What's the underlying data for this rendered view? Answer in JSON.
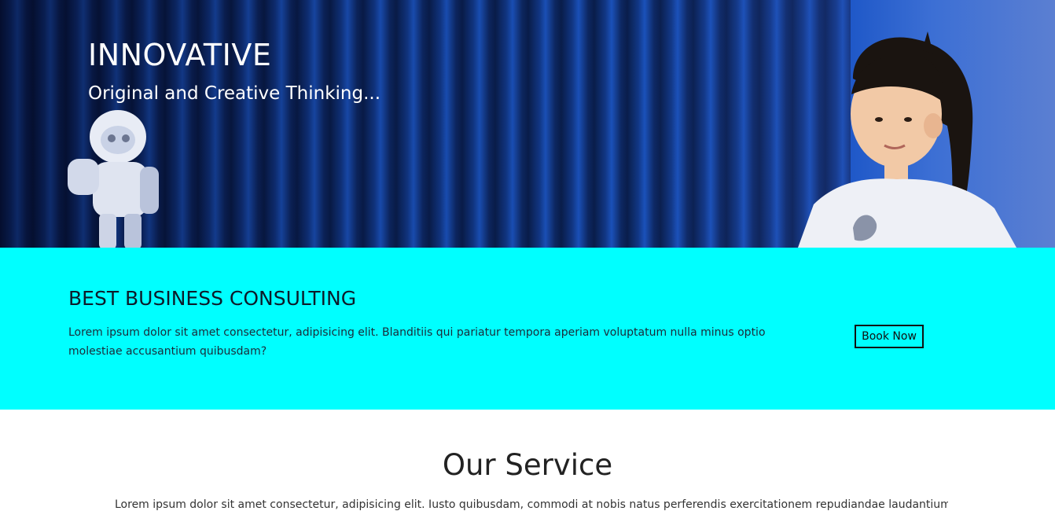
{
  "hero": {
    "title": "INNOVATIVE",
    "subtitle": "Original and Creative Thinking..."
  },
  "consulting": {
    "title": "BEST BUSINESS CONSULTING",
    "text": "Lorem ipsum dolor sit amet consectetur, adipisicing elit. Blanditiis qui pariatur tempora aperiam voluptatum nulla minus optio molestiae accusantium quibusdam?",
    "book_label": "Book Now",
    "background_color": "#00ffff"
  },
  "service": {
    "title": "Our Service",
    "text": "Lorem ipsum dolor sit amet consectetur, adipisicing elit. Iusto quibusdam, commodi at nobis natus perferendis exercitationem repudiandae laudantium"
  }
}
